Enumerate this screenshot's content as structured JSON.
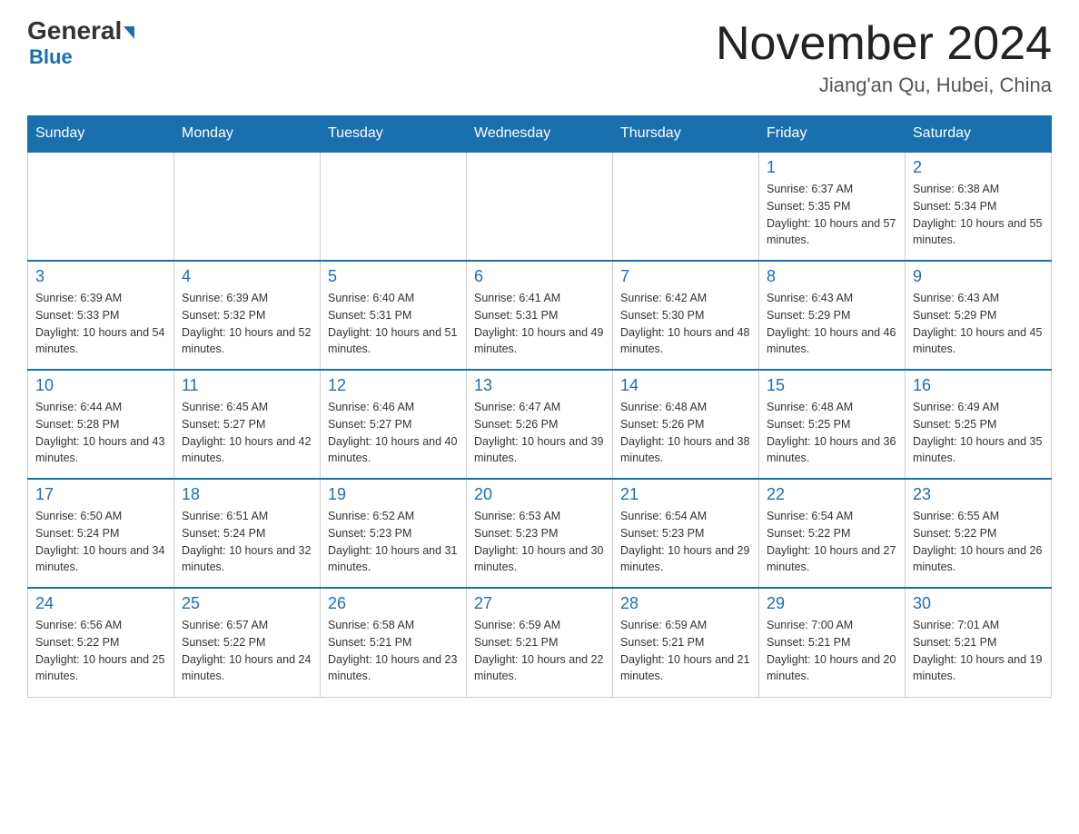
{
  "header": {
    "logo_general": "General",
    "logo_blue": "Blue",
    "month_title": "November 2024",
    "location": "Jiang'an Qu, Hubei, China"
  },
  "weekdays": [
    "Sunday",
    "Monday",
    "Tuesday",
    "Wednesday",
    "Thursday",
    "Friday",
    "Saturday"
  ],
  "weeks": [
    [
      {
        "day": "",
        "info": ""
      },
      {
        "day": "",
        "info": ""
      },
      {
        "day": "",
        "info": ""
      },
      {
        "day": "",
        "info": ""
      },
      {
        "day": "",
        "info": ""
      },
      {
        "day": "1",
        "info": "Sunrise: 6:37 AM\nSunset: 5:35 PM\nDaylight: 10 hours and 57 minutes."
      },
      {
        "day": "2",
        "info": "Sunrise: 6:38 AM\nSunset: 5:34 PM\nDaylight: 10 hours and 55 minutes."
      }
    ],
    [
      {
        "day": "3",
        "info": "Sunrise: 6:39 AM\nSunset: 5:33 PM\nDaylight: 10 hours and 54 minutes."
      },
      {
        "day": "4",
        "info": "Sunrise: 6:39 AM\nSunset: 5:32 PM\nDaylight: 10 hours and 52 minutes."
      },
      {
        "day": "5",
        "info": "Sunrise: 6:40 AM\nSunset: 5:31 PM\nDaylight: 10 hours and 51 minutes."
      },
      {
        "day": "6",
        "info": "Sunrise: 6:41 AM\nSunset: 5:31 PM\nDaylight: 10 hours and 49 minutes."
      },
      {
        "day": "7",
        "info": "Sunrise: 6:42 AM\nSunset: 5:30 PM\nDaylight: 10 hours and 48 minutes."
      },
      {
        "day": "8",
        "info": "Sunrise: 6:43 AM\nSunset: 5:29 PM\nDaylight: 10 hours and 46 minutes."
      },
      {
        "day": "9",
        "info": "Sunrise: 6:43 AM\nSunset: 5:29 PM\nDaylight: 10 hours and 45 minutes."
      }
    ],
    [
      {
        "day": "10",
        "info": "Sunrise: 6:44 AM\nSunset: 5:28 PM\nDaylight: 10 hours and 43 minutes."
      },
      {
        "day": "11",
        "info": "Sunrise: 6:45 AM\nSunset: 5:27 PM\nDaylight: 10 hours and 42 minutes."
      },
      {
        "day": "12",
        "info": "Sunrise: 6:46 AM\nSunset: 5:27 PM\nDaylight: 10 hours and 40 minutes."
      },
      {
        "day": "13",
        "info": "Sunrise: 6:47 AM\nSunset: 5:26 PM\nDaylight: 10 hours and 39 minutes."
      },
      {
        "day": "14",
        "info": "Sunrise: 6:48 AM\nSunset: 5:26 PM\nDaylight: 10 hours and 38 minutes."
      },
      {
        "day": "15",
        "info": "Sunrise: 6:48 AM\nSunset: 5:25 PM\nDaylight: 10 hours and 36 minutes."
      },
      {
        "day": "16",
        "info": "Sunrise: 6:49 AM\nSunset: 5:25 PM\nDaylight: 10 hours and 35 minutes."
      }
    ],
    [
      {
        "day": "17",
        "info": "Sunrise: 6:50 AM\nSunset: 5:24 PM\nDaylight: 10 hours and 34 minutes."
      },
      {
        "day": "18",
        "info": "Sunrise: 6:51 AM\nSunset: 5:24 PM\nDaylight: 10 hours and 32 minutes."
      },
      {
        "day": "19",
        "info": "Sunrise: 6:52 AM\nSunset: 5:23 PM\nDaylight: 10 hours and 31 minutes."
      },
      {
        "day": "20",
        "info": "Sunrise: 6:53 AM\nSunset: 5:23 PM\nDaylight: 10 hours and 30 minutes."
      },
      {
        "day": "21",
        "info": "Sunrise: 6:54 AM\nSunset: 5:23 PM\nDaylight: 10 hours and 29 minutes."
      },
      {
        "day": "22",
        "info": "Sunrise: 6:54 AM\nSunset: 5:22 PM\nDaylight: 10 hours and 27 minutes."
      },
      {
        "day": "23",
        "info": "Sunrise: 6:55 AM\nSunset: 5:22 PM\nDaylight: 10 hours and 26 minutes."
      }
    ],
    [
      {
        "day": "24",
        "info": "Sunrise: 6:56 AM\nSunset: 5:22 PM\nDaylight: 10 hours and 25 minutes."
      },
      {
        "day": "25",
        "info": "Sunrise: 6:57 AM\nSunset: 5:22 PM\nDaylight: 10 hours and 24 minutes."
      },
      {
        "day": "26",
        "info": "Sunrise: 6:58 AM\nSunset: 5:21 PM\nDaylight: 10 hours and 23 minutes."
      },
      {
        "day": "27",
        "info": "Sunrise: 6:59 AM\nSunset: 5:21 PM\nDaylight: 10 hours and 22 minutes."
      },
      {
        "day": "28",
        "info": "Sunrise: 6:59 AM\nSunset: 5:21 PM\nDaylight: 10 hours and 21 minutes."
      },
      {
        "day": "29",
        "info": "Sunrise: 7:00 AM\nSunset: 5:21 PM\nDaylight: 10 hours and 20 minutes."
      },
      {
        "day": "30",
        "info": "Sunrise: 7:01 AM\nSunset: 5:21 PM\nDaylight: 10 hours and 19 minutes."
      }
    ]
  ]
}
